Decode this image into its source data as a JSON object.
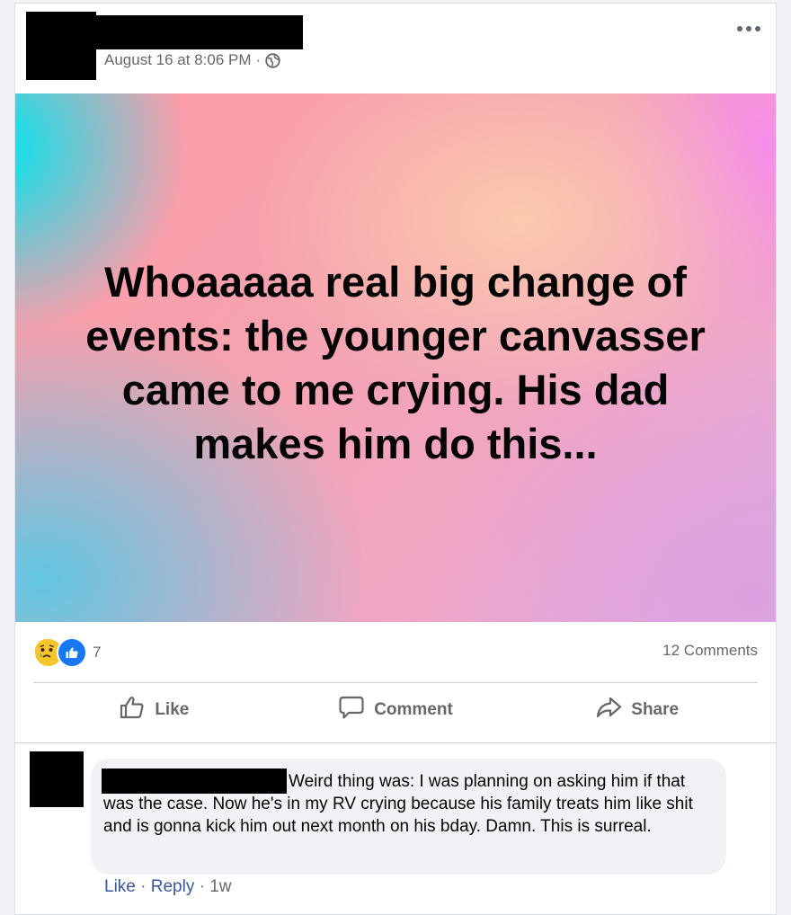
{
  "post": {
    "timestamp": "August 16 at 8:06 PM",
    "separator": "·",
    "privacy_icon": "globe-icon",
    "more_icon": "more-options-icon",
    "text": "Whoaaaaa real big change of events: the younger canvasser came to me crying. His dad makes him do this..."
  },
  "reactions": {
    "icons": [
      "sad-reaction-icon",
      "like-reaction-icon"
    ],
    "count": "7",
    "comments_label": "12 Comments"
  },
  "actions": {
    "like": "Like",
    "comment": "Comment",
    "share": "Share"
  },
  "comment": {
    "text": "Weird thing was: I was planning on asking him if that was the case. Now he's in my RV crying because his family treats him like shit and is gonna kick him out next month on his bday. Damn. This is surreal.",
    "like": "Like",
    "reply": "Reply",
    "age": "1w",
    "separator": "·"
  },
  "colors": {
    "link": "#385898",
    "secondary_text": "#65676b",
    "like_blue": "#1877f2",
    "sad_yellow": "#f7c52c"
  }
}
